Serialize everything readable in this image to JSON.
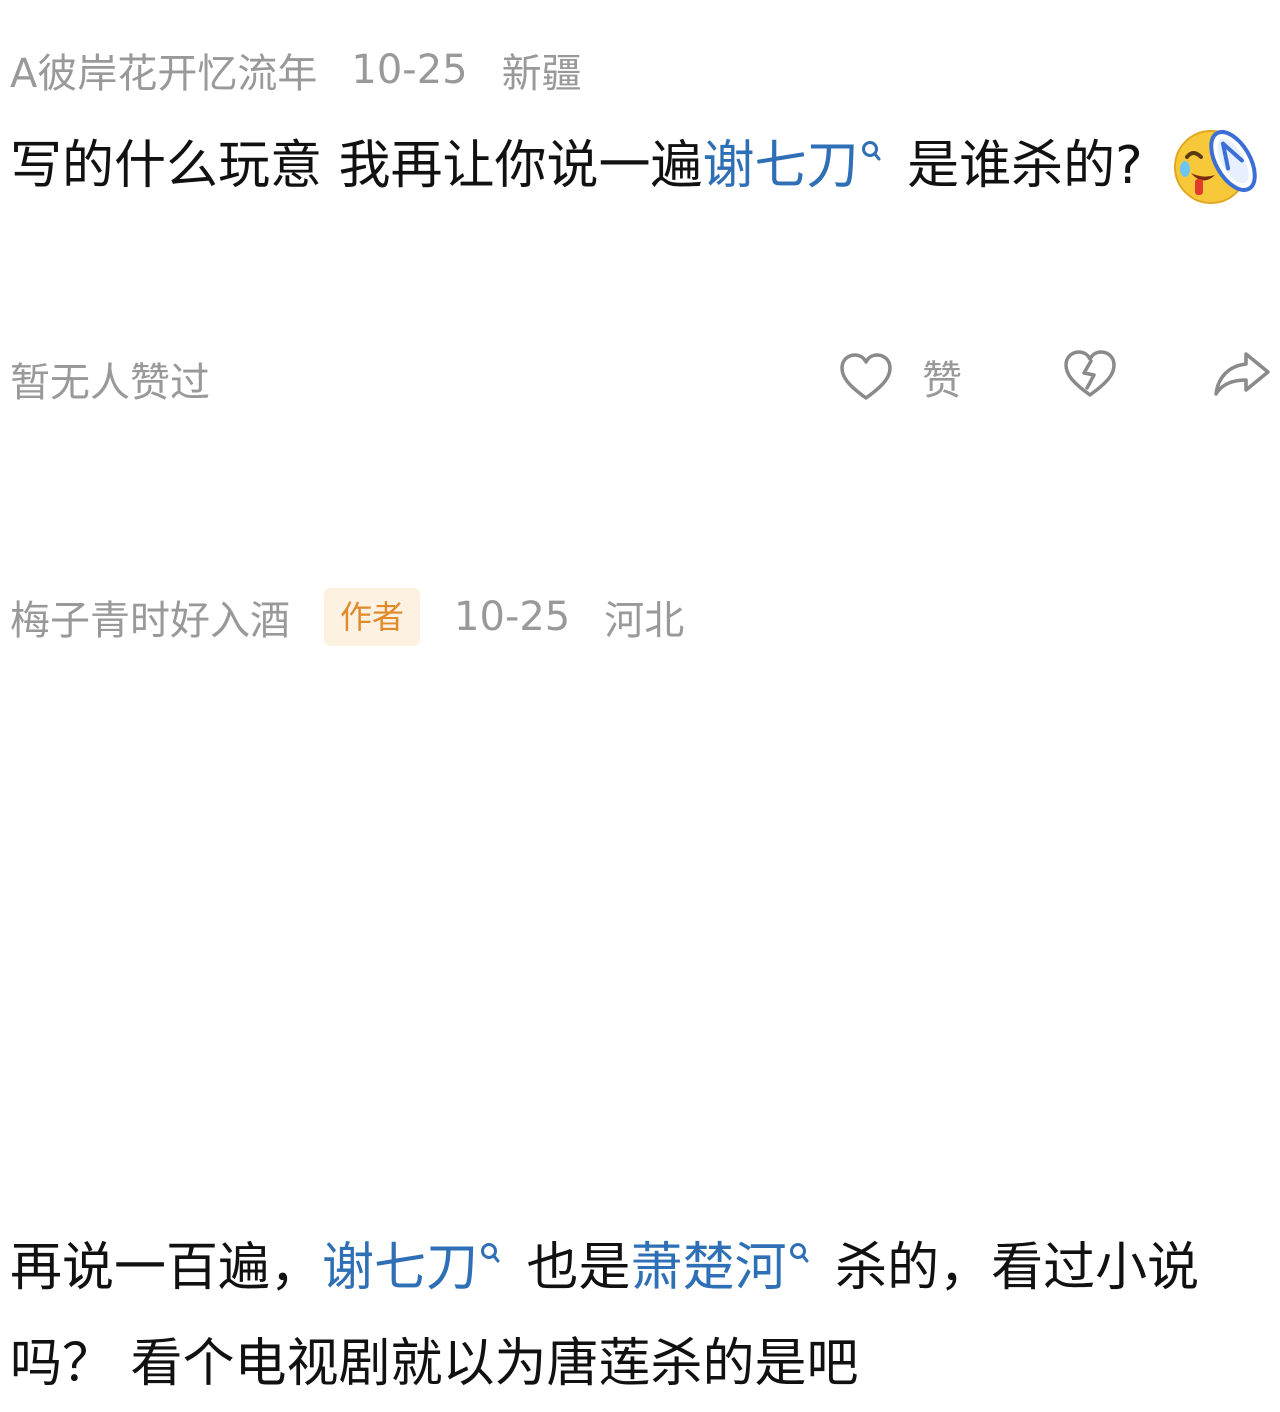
{
  "comments": [
    {
      "username": "A彼岸花开忆流年",
      "date": "10-25",
      "location": "新疆",
      "text_parts": {
        "p1": "写的什么玩意 我再让你说一遍",
        "link1": "谢七刀",
        "p2": " 是谁杀的?"
      },
      "emoji": "crying-laughing-slipper-emoji",
      "no_likes_text": "暂无人赞过",
      "like_label": "赞"
    },
    {
      "username": "梅子青时好入酒",
      "badge": "作者",
      "date": "10-25",
      "location": "河北",
      "text_parts": {
        "p1": "再说一百遍，",
        "link1": "谢七刀",
        "p2": " 也是",
        "link2": "萧楚河",
        "p3": " 杀的，看过小说吗？ 看个电视剧就以为唐莲杀的是吧"
      }
    }
  ],
  "colors": {
    "meta_gray": "#999999",
    "link_blue": "#2f6fb5",
    "badge_bg": "#fdf1e2",
    "badge_text": "#e08a2a"
  },
  "icons": [
    "search-icon",
    "heart-icon",
    "broken-heart-icon",
    "share-icon"
  ]
}
